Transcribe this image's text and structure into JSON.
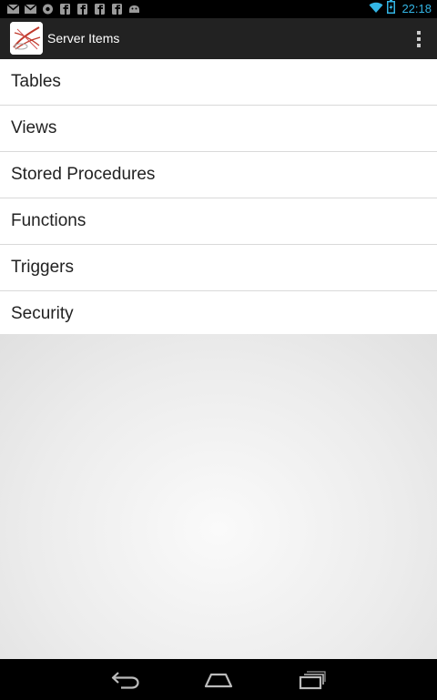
{
  "status_bar": {
    "time": "22:18",
    "notification_icons": [
      "gmail-icon",
      "gmail-icon",
      "notification-icon",
      "facebook-icon",
      "facebook-icon",
      "facebook-icon",
      "facebook-icon",
      "android-icon"
    ],
    "accent": "#33b5e5"
  },
  "action_bar": {
    "title": "Server Items"
  },
  "list": {
    "items": [
      {
        "label": "Tables"
      },
      {
        "label": "Views"
      },
      {
        "label": "Stored Procedures"
      },
      {
        "label": "Functions"
      },
      {
        "label": "Triggers"
      },
      {
        "label": "Security"
      }
    ]
  },
  "nav_bar": {
    "buttons": [
      "back-icon",
      "home-icon",
      "recent-apps-icon"
    ]
  }
}
